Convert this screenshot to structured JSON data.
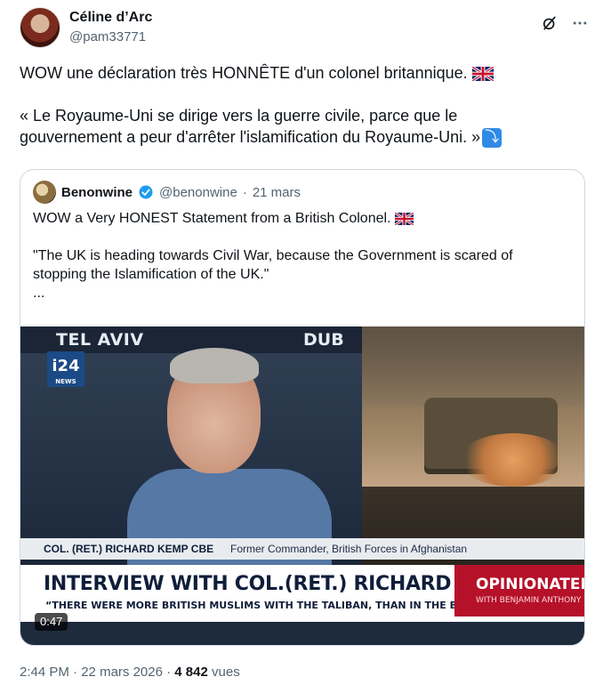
{
  "author": {
    "name": "Céline d’Arc",
    "handle": "@pam33771",
    "avatar": "avatar"
  },
  "header_icons": [
    "grok-icon",
    "more-icon"
  ],
  "tweet": {
    "line1": "WOW une déclaration très HONNÊTE d'un colonel britannique.",
    "line2a": "« Le Royaume-Uni se dirige vers la guerre civile, parce que le",
    "line2b": "gouvernement a peur d'arrêter l'islamification du Royaume-Uni. »",
    "arrow_glyph": "⤵"
  },
  "quoted": {
    "name": "Benonwine",
    "handle": "@benonwine",
    "separator": "·",
    "date": "21 mars",
    "line1": "WOW a Very HONEST Statement from a British Colonel.",
    "line2": "\"The UK is heading towards Civil War, because the Government is scared of",
    "line3": "stopping the Islamification of the UK.\"",
    "line4": "...",
    "video": {
      "top_left": "TEL AVIV",
      "top_right": "DUB",
      "logo": "i24",
      "logo_sub": "NEWS",
      "name_line": "COL. (RET.) RICHARD KEMP CBE",
      "role_line": "Former Commander, British Forces in Afghanistan",
      "title": "INTERVIEW WITH COL.(RET.) RICHARD KEMP",
      "quote": "“THERE WERE MORE BRITISH MUSLIMS WITH THE TALIBAN, THAN IN THE BRITISH ARMY”",
      "brand_big": "OPINIONATED",
      "brand_small": "WITH BENJAMIN ANTHONY",
      "timecode": "0:47"
    }
  },
  "footer": {
    "time": "2:44 PM",
    "separator": "·",
    "date": "22 mars 2026",
    "separator2": "·",
    "views_count": "4 842",
    "views_label": "vues"
  },
  "colors": {
    "text": "#0f1419",
    "muted": "#536471",
    "border": "#cfd9de",
    "verified": "#1d9bf0",
    "arrow_badge": "#2f8ae6",
    "opinion_red": "#b5122a"
  }
}
